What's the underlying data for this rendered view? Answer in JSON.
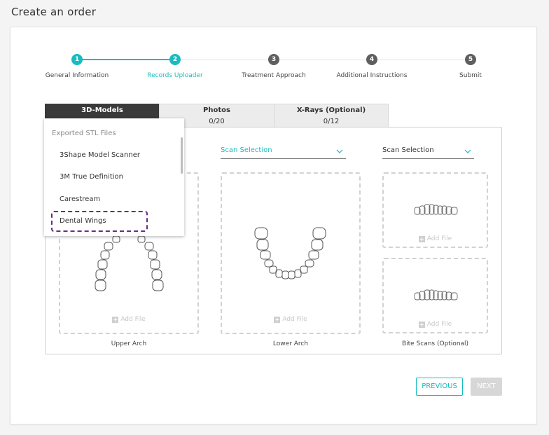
{
  "page": {
    "title": "Create an order"
  },
  "stepper": {
    "steps": [
      {
        "number": "1",
        "label": "General Information"
      },
      {
        "number": "2",
        "label": "Records Uploader"
      },
      {
        "number": "3",
        "label": "Treatment Approach"
      },
      {
        "number": "4",
        "label": "Additional Instructions"
      },
      {
        "number": "5",
        "label": "Submit"
      }
    ],
    "current_step": 2
  },
  "tabs": [
    {
      "title": "3D-Models",
      "count": ""
    },
    {
      "title": "Photos",
      "count": "0/20"
    },
    {
      "title": "X-Rays (Optional)",
      "count": "0/12"
    }
  ],
  "dropdown": {
    "header": "Exported STL Files",
    "items": [
      "3Shape Model Scanner",
      "3M True Definition",
      "Carestream",
      "Dental Wings"
    ]
  },
  "scan_selects": {
    "lower": "Scan Selection",
    "bite": "Scan Selection"
  },
  "zones": {
    "add_file": "Add File",
    "upper_caption": "Upper Arch",
    "lower_caption": "Lower Arch",
    "bite_caption": "Bite Scans (Optional)"
  },
  "buttons": {
    "previous": "PREVIOUS",
    "next": "NEXT"
  },
  "colors": {
    "accent": "#18bcc0",
    "highlight": "#6b2a86",
    "step_inactive": "#5f5f5f"
  }
}
